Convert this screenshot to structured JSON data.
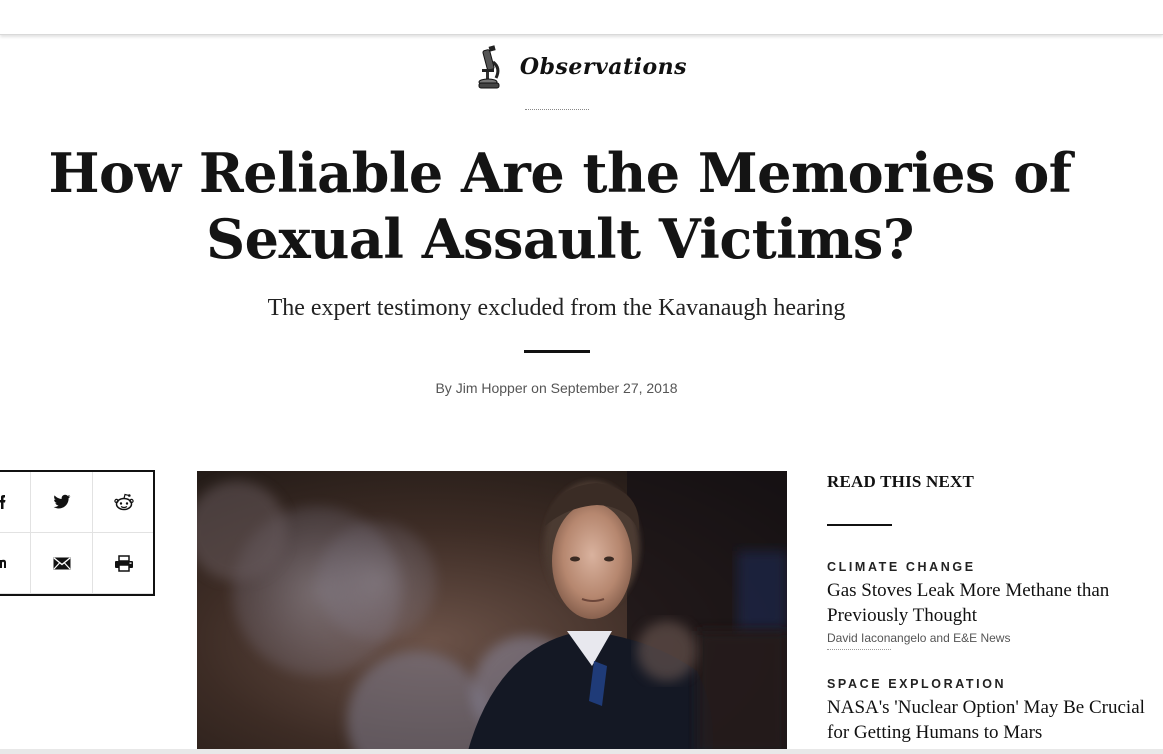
{
  "column": {
    "name": "Observations",
    "icon": "microscope-icon"
  },
  "article": {
    "headline_line1": "How Reliable Are the Memories of",
    "headline_line2": "Sexual Assault Victims?",
    "subhead": "The expert testimony excluded from the Kavanaugh hearing",
    "byline_prefix": "By ",
    "author": "Jim Hopper",
    "byline_on": " on ",
    "date": "September 27, 2018"
  },
  "share": {
    "icons": [
      "facebook-icon",
      "twitter-icon",
      "reddit-icon",
      "linkedin-icon",
      "email-icon",
      "print-icon"
    ]
  },
  "sidebar": {
    "title": "READ THIS NEXT",
    "stories": [
      {
        "category": "CLIMATE CHANGE",
        "title_line1": "Gas Stoves Leak More Methane than",
        "title_line2": "Previously Thought",
        "author": "David Iaconangelo and E&E News"
      },
      {
        "category": "SPACE EXPLORATION",
        "title_line1": "NASA's 'Nuclear Option' May Be Crucial",
        "title_line2": "for Getting Humans to Mars"
      }
    ]
  },
  "colors": {
    "text": "#111111",
    "muted": "#555555",
    "background": "#ffffff"
  }
}
